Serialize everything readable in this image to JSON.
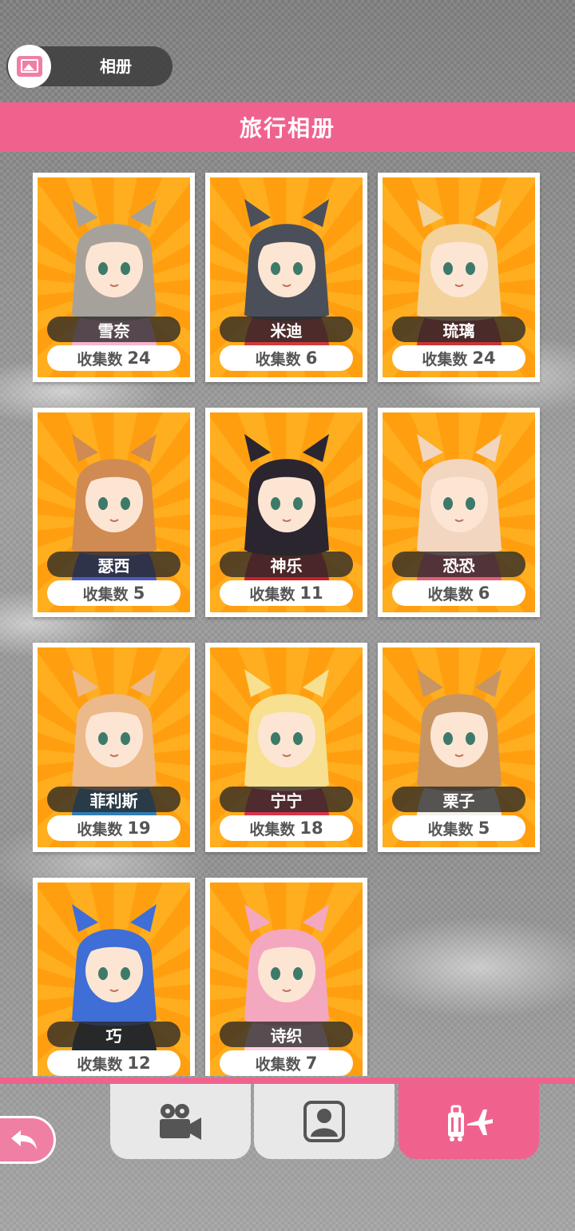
{
  "top_bar": {
    "album_label": "相册"
  },
  "header": {
    "title": "旅行相册"
  },
  "count_label": "收集数",
  "characters": [
    {
      "name": "雪奈",
      "count": "24",
      "hair": "#a7a19c",
      "accent": "#f5b6cf"
    },
    {
      "name": "米迪",
      "count": "6",
      "hair": "#4b4f5a",
      "accent": "#d23a3a"
    },
    {
      "name": "琉璃",
      "count": "24",
      "hair": "#f3d39b",
      "accent": "#c93535"
    },
    {
      "name": "瑟西",
      "count": "5",
      "hair": "#cf8b52",
      "accent": "#4b5ac2"
    },
    {
      "name": "神乐",
      "count": "11",
      "hair": "#2b2530",
      "accent": "#c8202a"
    },
    {
      "name": "恐恐",
      "count": "6",
      "hair": "#f2d6c0",
      "accent": "#e65d78"
    },
    {
      "name": "菲利斯",
      "count": "19",
      "hair": "#ecb98a",
      "accent": "#2f7fb8"
    },
    {
      "name": "宁宁",
      "count": "18",
      "hair": "#f7e08f",
      "accent": "#d8334a"
    },
    {
      "name": "栗子",
      "count": "5",
      "hair": "#c69563",
      "accent": "#f4f0ea"
    },
    {
      "name": "巧",
      "count": "12",
      "hair": "#3e6ed6",
      "accent": "#222a33"
    },
    {
      "name": "诗织",
      "count": "7",
      "hair": "#f3a8c0",
      "accent": "#fdd3df"
    }
  ],
  "bottom_tabs": [
    {
      "id": "video",
      "icon": "video-camera-icon",
      "active": false
    },
    {
      "id": "person",
      "icon": "person-portrait-icon",
      "active": false
    },
    {
      "id": "travel",
      "icon": "luggage-plane-icon",
      "active": true
    }
  ],
  "colors": {
    "accent": "#f0628e",
    "card_bg": "#ffa514"
  }
}
